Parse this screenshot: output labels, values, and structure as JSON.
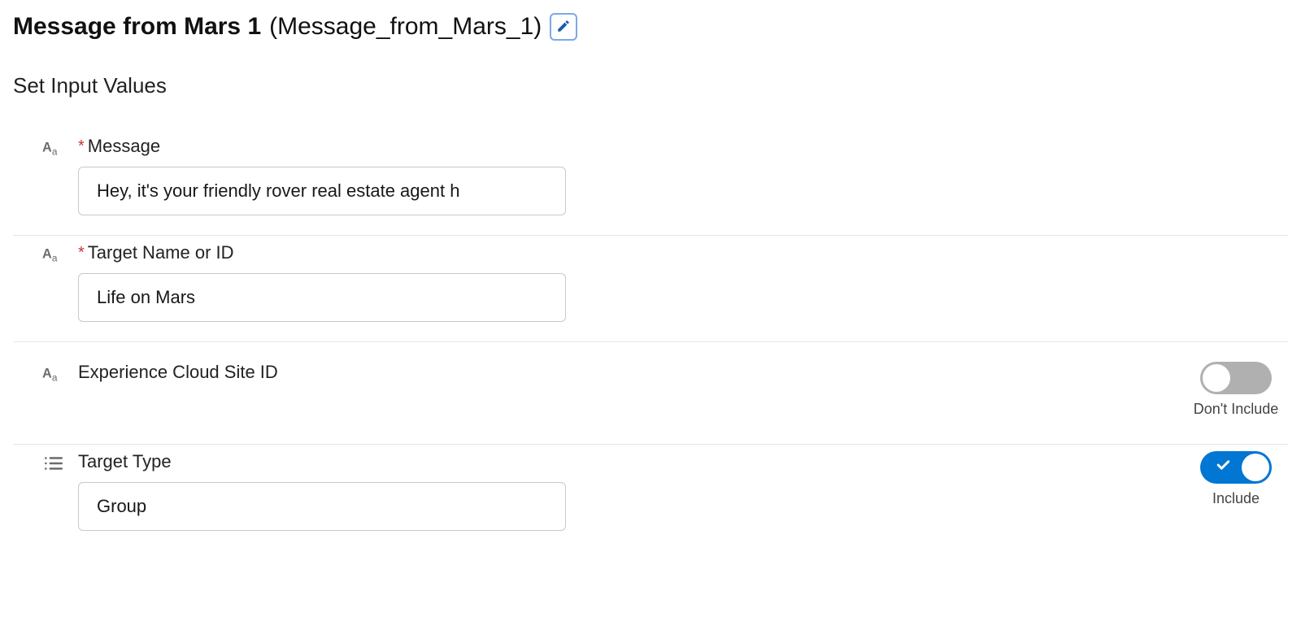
{
  "header": {
    "title": "Message from Mars 1",
    "api_name": "(Message_from_Mars_1)"
  },
  "section_title": "Set Input Values",
  "fields": {
    "message": {
      "label": "Message",
      "required_marker": "*",
      "value": "Hey, it's your friendly rover real estate agent h"
    },
    "target_name": {
      "label": "Target Name or ID",
      "required_marker": "*",
      "value": "Life on Mars"
    },
    "site_id": {
      "label": "Experience Cloud Site ID",
      "toggle_label": "Don't Include"
    },
    "target_type": {
      "label": "Target Type",
      "value": "Group",
      "toggle_label": "Include"
    }
  }
}
